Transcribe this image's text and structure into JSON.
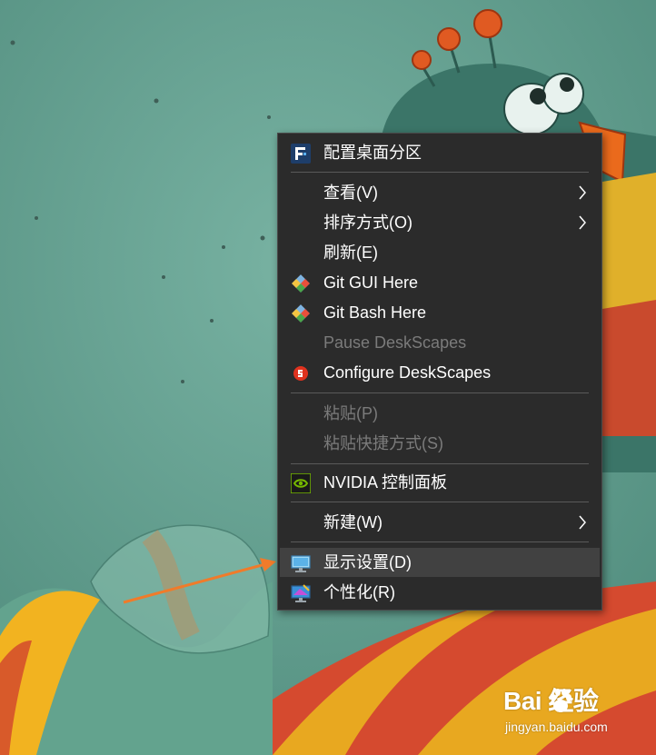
{
  "colors": {
    "menu_background": "#2b2b2b",
    "menu_hover": "#414141",
    "menu_text": "#ffffff",
    "menu_disabled_text": "#7b7b7b",
    "separator": "#5a5a5a",
    "annotation_arrow": "#f07b2a",
    "desktop_background": "#6aa494"
  },
  "context_menu": {
    "items": [
      {
        "label": "配置桌面分区",
        "icon": "fences-icon"
      },
      {
        "label": "查看(V)",
        "submenu": true
      },
      {
        "label": "排序方式(O)",
        "submenu": true
      },
      {
        "label": "刷新(E)"
      },
      {
        "label": "Git GUI Here",
        "icon": "git-icon"
      },
      {
        "label": "Git Bash Here",
        "icon": "git-icon"
      },
      {
        "label": "Pause DeskScapes",
        "disabled": true
      },
      {
        "label": "Configure DeskScapes",
        "icon": "deskscapes-icon"
      },
      {
        "label": "粘贴(P)",
        "disabled": true
      },
      {
        "label": "粘贴快捷方式(S)",
        "disabled": true
      },
      {
        "label": "NVIDIA 控制面板",
        "icon": "nvidia-icon"
      },
      {
        "label": "新建(W)",
        "submenu": true
      },
      {
        "label": "显示设置(D)",
        "icon": "display-settings-icon",
        "highlighted": true
      },
      {
        "label": "个性化(R)",
        "icon": "personalize-icon"
      }
    ]
  },
  "watermark": {
    "title": "Bai  经验",
    "subtitle": "jingyan.baidu.com"
  }
}
